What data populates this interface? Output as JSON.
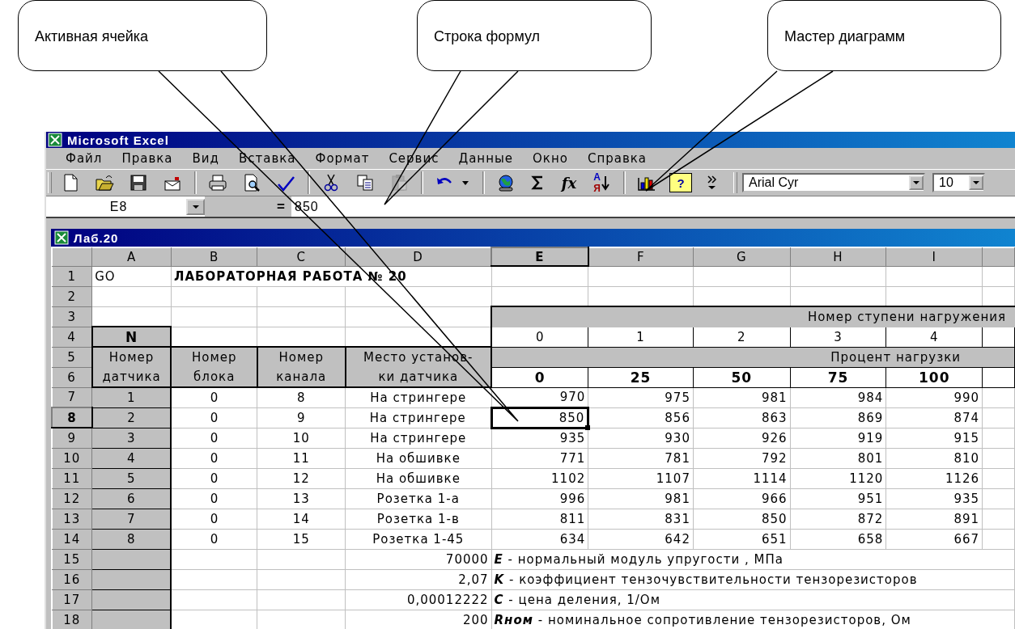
{
  "callouts": [
    {
      "text": "Активная ячейка"
    },
    {
      "text": "Строка формул"
    },
    {
      "text": "Мастер диаграмм"
    }
  ],
  "app": {
    "title": "Microsoft Excel",
    "menu": [
      "Файл",
      "Правка",
      "Вид",
      "Вставка",
      "Формат",
      "Сервис",
      "Данные",
      "Окно",
      "Справка"
    ],
    "toolbar": [
      {
        "kind": "new"
      },
      {
        "kind": "open"
      },
      {
        "kind": "save"
      },
      {
        "kind": "mail"
      },
      {
        "kind": "separator"
      },
      {
        "kind": "print"
      },
      {
        "kind": "preview"
      },
      {
        "kind": "spelling"
      },
      {
        "kind": "separator"
      },
      {
        "kind": "cut"
      },
      {
        "kind": "copy"
      },
      {
        "kind": "paste",
        "disabled": true
      },
      {
        "kind": "separator"
      },
      {
        "kind": "undo"
      },
      {
        "kind": "caret"
      },
      {
        "kind": "separator"
      },
      {
        "kind": "globe"
      },
      {
        "kind": "sum"
      },
      {
        "kind": "glyph",
        "text": "fx"
      },
      {
        "kind": "sort",
        "top": "А",
        "bottom": "Я"
      },
      {
        "kind": "separator"
      },
      {
        "kind": "chart"
      },
      {
        "kind": "help",
        "text": "?"
      },
      {
        "kind": "more"
      }
    ],
    "font": "Arial Cyr",
    "font_size": "10",
    "name_box": "E8",
    "formula_sign": "=",
    "formula": "850"
  },
  "workbook": {
    "title": "Лаб.20",
    "columns": [
      {
        "label": "A",
        "selected": false
      },
      {
        "label": "B",
        "selected": false
      },
      {
        "label": "C",
        "selected": false
      },
      {
        "label": "D",
        "selected": false
      },
      {
        "label": "E",
        "selected": true
      },
      {
        "label": "F",
        "selected": false
      },
      {
        "label": "G",
        "selected": false
      },
      {
        "label": "H",
        "selected": false
      },
      {
        "label": "I",
        "selected": false
      }
    ],
    "rows": [
      {
        "label": "1",
        "selected": false
      },
      {
        "label": "2",
        "selected": false
      },
      {
        "label": "3",
        "selected": false
      },
      {
        "label": "4",
        "selected": false
      },
      {
        "label": "5",
        "selected": false
      },
      {
        "label": "6",
        "selected": false
      },
      {
        "label": "7",
        "selected": false
      },
      {
        "label": "8",
        "selected": true
      },
      {
        "label": "9",
        "selected": false
      },
      {
        "label": "10",
        "selected": false
      },
      {
        "label": "11",
        "selected": false
      },
      {
        "label": "12",
        "selected": false
      },
      {
        "label": "13",
        "selected": false
      },
      {
        "label": "14",
        "selected": false
      },
      {
        "label": "15",
        "selected": false
      },
      {
        "label": "16",
        "selected": false
      },
      {
        "label": "17",
        "selected": false
      },
      {
        "label": "18",
        "selected": false
      }
    ],
    "sheet": {
      "a1": "GO",
      "title": "ЛАБОРАТОРНАЯ РАБОТА № 20",
      "stage_header": "Номер ступени нагружения",
      "n_header": "N",
      "stages": [
        "0",
        "1",
        "2",
        "3",
        "4"
      ],
      "columns_top": [
        "Номер",
        "Номер",
        "Номер",
        "Место установ-"
      ],
      "columns_bottom": [
        "датчика",
        "блока",
        "канала",
        "ки датчика"
      ],
      "percent_header": "Процент нагрузки",
      "percents": [
        "0",
        "25",
        "50",
        "75",
        "100"
      ],
      "sensors": [
        {
          "number": "1",
          "block": "0",
          "channel": "8",
          "place": "На стрингере",
          "readings": [
            {
              "value": "970",
              "active": false
            },
            {
              "value": "975",
              "active": false
            },
            {
              "value": "981",
              "active": false
            },
            {
              "value": "984",
              "active": false
            },
            {
              "value": "990",
              "active": false
            }
          ]
        },
        {
          "number": "2",
          "block": "0",
          "channel": "9",
          "place": "На стрингере",
          "readings": [
            {
              "value": "850",
              "active": true
            },
            {
              "value": "856",
              "active": false
            },
            {
              "value": "863",
              "active": false
            },
            {
              "value": "869",
              "active": false
            },
            {
              "value": "874",
              "active": false
            }
          ]
        },
        {
          "number": "3",
          "block": "0",
          "channel": "10",
          "place": "На стрингере",
          "readings": [
            {
              "value": "935",
              "active": false
            },
            {
              "value": "930",
              "active": false
            },
            {
              "value": "926",
              "active": false
            },
            {
              "value": "919",
              "active": false
            },
            {
              "value": "915",
              "active": false
            }
          ]
        },
        {
          "number": "4",
          "block": "0",
          "channel": "11",
          "place": "На обшивке",
          "readings": [
            {
              "value": "771",
              "active": false
            },
            {
              "value": "781",
              "active": false
            },
            {
              "value": "792",
              "active": false
            },
            {
              "value": "801",
              "active": false
            },
            {
              "value": "810",
              "active": false
            }
          ]
        },
        {
          "number": "5",
          "block": "0",
          "channel": "12",
          "place": "На обшивке",
          "readings": [
            {
              "value": "1102",
              "active": false
            },
            {
              "value": "1107",
              "active": false
            },
            {
              "value": "1114",
              "active": false
            },
            {
              "value": "1120",
              "active": false
            },
            {
              "value": "1126",
              "active": false
            }
          ]
        },
        {
          "number": "6",
          "block": "0",
          "channel": "13",
          "place": "Розетка 1-а",
          "readings": [
            {
              "value": "996",
              "active": false
            },
            {
              "value": "981",
              "active": false
            },
            {
              "value": "966",
              "active": false
            },
            {
              "value": "951",
              "active": false
            },
            {
              "value": "935",
              "active": false
            }
          ]
        },
        {
          "number": "7",
          "block": "0",
          "channel": "14",
          "place": "Розетка 1-в",
          "readings": [
            {
              "value": "811",
              "active": false
            },
            {
              "value": "831",
              "active": false
            },
            {
              "value": "850",
              "active": false
            },
            {
              "value": "872",
              "active": false
            },
            {
              "value": "891",
              "active": false
            }
          ]
        },
        {
          "number": "8",
          "block": "0",
          "channel": "15",
          "place": "Розетка 1-45",
          "readings": [
            {
              "value": "634",
              "active": false
            },
            {
              "value": "642",
              "active": false
            },
            {
              "value": "651",
              "active": false
            },
            {
              "value": "658",
              "active": false
            },
            {
              "value": "667",
              "active": false
            }
          ]
        }
      ],
      "constants": [
        {
          "value": "70000",
          "description": "**E** - нормальный модуль упругости , МПа"
        },
        {
          "value": "2,07",
          "description": "**K** - коэффициент тензочувствительности тензорезисторов"
        },
        {
          "value": "0,00012222",
          "description": "**C** - цена деления, 1/Ом"
        },
        {
          "value": "200",
          "description": "**Rном** - номинальное сопротивление тензорезисторов, Ом"
        }
      ]
    }
  }
}
